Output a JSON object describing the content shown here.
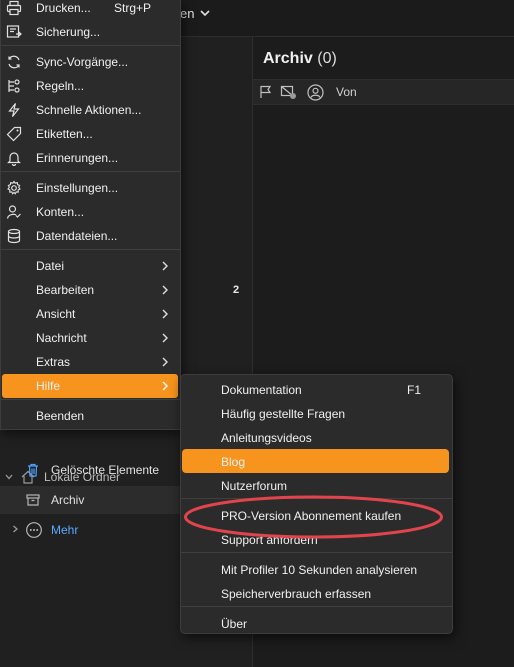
{
  "topbar": {
    "text": "en"
  },
  "left_pane": {
    "badge": "2",
    "folders": {
      "header": "Lokale Ordner",
      "items": [
        {
          "label": "Gelöschte Elemente",
          "icon": "trash-icon"
        },
        {
          "label": "Archiv",
          "icon": "archive-icon",
          "selected": true
        }
      ],
      "more": "Mehr"
    }
  },
  "content": {
    "title": "Archiv",
    "count": "(0)",
    "columns": {
      "from": "Von"
    }
  },
  "menu": {
    "items": [
      {
        "label": "Drucken...",
        "shortcut": "Strg+P",
        "icon": "printer-icon"
      },
      {
        "label": "Sicherung...",
        "icon": "backup-icon"
      },
      {
        "label": "Sync-Vorgänge...",
        "icon": "sync-icon"
      },
      {
        "label": "Regeln...",
        "icon": "rules-icon"
      },
      {
        "label": "Schnelle Aktionen...",
        "icon": "lightning-icon"
      },
      {
        "label": "Etiketten...",
        "icon": "tag-icon"
      },
      {
        "label": "Erinnerungen...",
        "icon": "bell-icon"
      },
      {
        "label": "Einstellungen...",
        "icon": "gear-icon"
      },
      {
        "label": "Konten...",
        "icon": "account-icon"
      },
      {
        "label": "Datendateien...",
        "icon": "database-icon"
      },
      {
        "label": "Datei"
      },
      {
        "label": "Bearbeiten"
      },
      {
        "label": "Ansicht"
      },
      {
        "label": "Nachricht"
      },
      {
        "label": "Extras"
      },
      {
        "label": "Hilfe"
      },
      {
        "label": "Beenden"
      }
    ]
  },
  "submenu": {
    "items": [
      {
        "label": "Dokumentation",
        "shortcut": "F1"
      },
      {
        "label": "Häufig gestellte Fragen"
      },
      {
        "label": "Anleitungsvideos"
      },
      {
        "label": "Blog"
      },
      {
        "label": "Nutzerforum"
      },
      {
        "label": "PRO-Version Abonnement kaufen"
      },
      {
        "label": "Support anfordern"
      },
      {
        "label": "Mit Profiler 10 Sekunden analysieren"
      },
      {
        "label": "Speicherverbrauch erfassen"
      },
      {
        "label": "Über"
      }
    ]
  },
  "colors": {
    "accent": "#f7941d",
    "highlight_ring": "#e0444c",
    "link": "#5aa9ff"
  }
}
